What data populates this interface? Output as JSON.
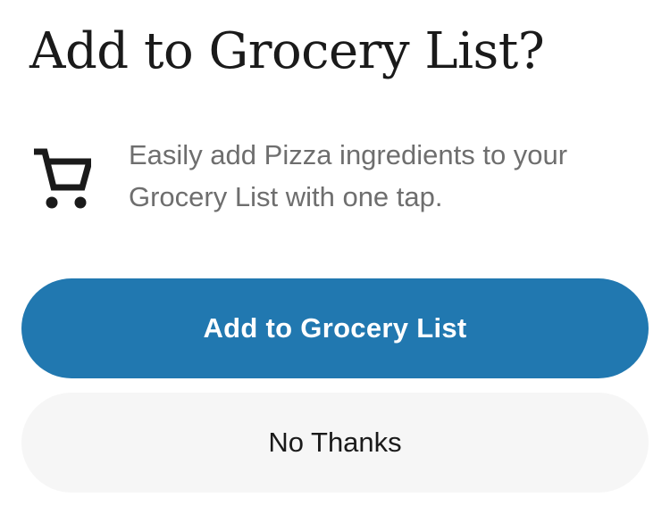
{
  "dialog": {
    "title": "Add to Grocery List?",
    "message": "Easily add Pizza ingredients to your Grocery List with one tap.",
    "icon": "shopping-cart-icon",
    "primary_button_label": "Add to Grocery List",
    "secondary_button_label": "No Thanks"
  },
  "colors": {
    "primary": "#2178b0",
    "secondary_bg": "#f6f6f6",
    "title_text": "#1a1a1a",
    "body_text": "#6e6e6e"
  }
}
